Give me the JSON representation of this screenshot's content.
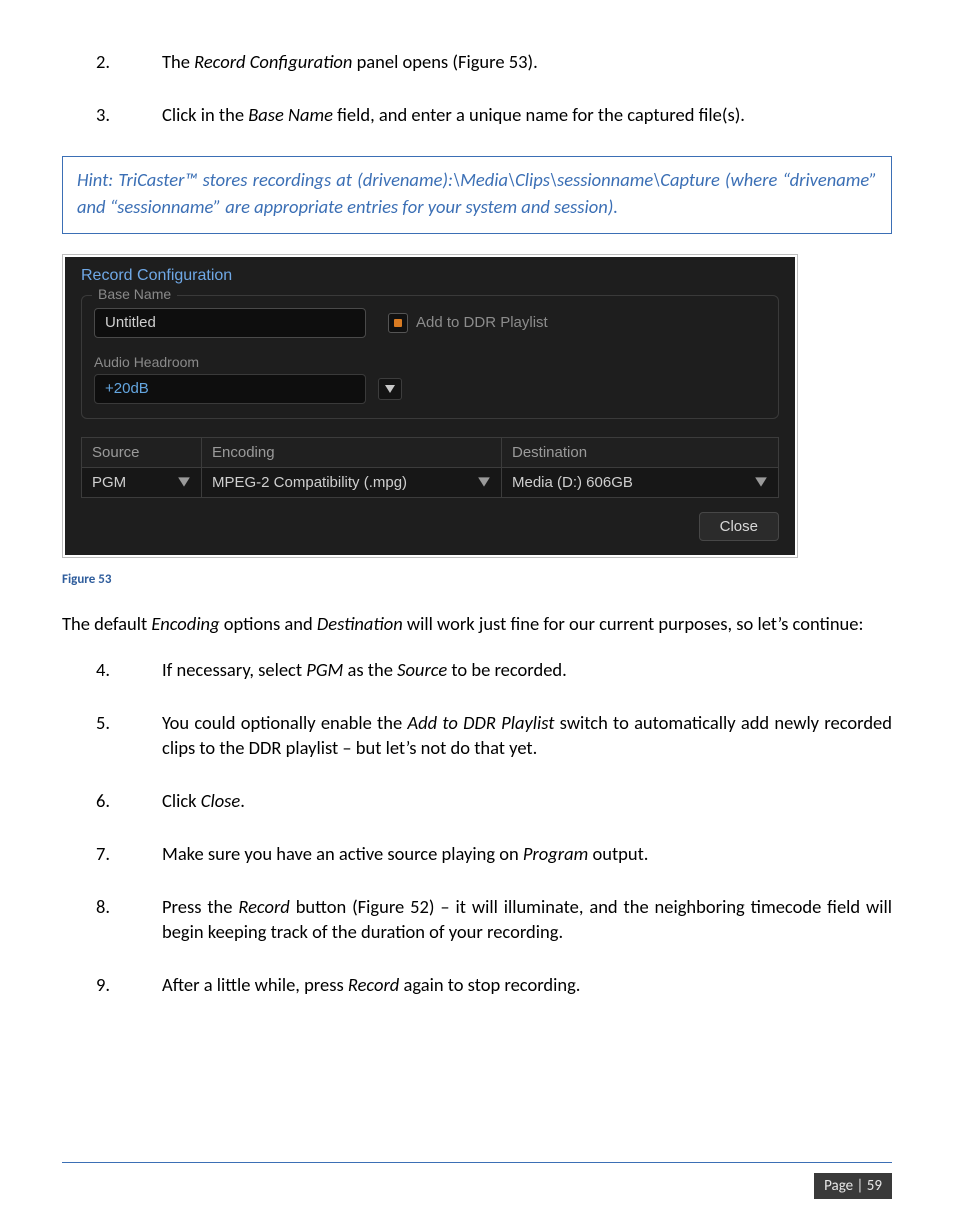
{
  "list_top": [
    {
      "num": "2.",
      "html": "The <i>Record Configuration</i> panel opens (Figure 53)."
    },
    {
      "num": "3.",
      "html": "Click in the <i>Base Name</i> field, and enter a unique name for the captured file(s)."
    }
  ],
  "hint": "Hint: TriCaster™ stores recordings at (drivename):\\Media\\Clips\\sessionname\\Capture (where “drivename” and “sessionname” are appropriate entries for your system and session).",
  "panel": {
    "title": "Record Configuration",
    "group_label": "Base Name",
    "basename_value": "Untitled",
    "ddr_checkbox_label": "Add to DDR Playlist",
    "ddr_checked": false,
    "headroom_label": "Audio Headroom",
    "headroom_value": "+20dB",
    "columns": {
      "source": "Source",
      "encoding": "Encoding",
      "destination": "Destination"
    },
    "row": {
      "source": "PGM",
      "encoding": "MPEG-2 Compatibility (.mpg)",
      "destination": "Media (D:) 606GB"
    },
    "close_label": "Close"
  },
  "figure_caption": "Figure 53",
  "para_after": "The default <i>Encoding</i> options and <i>Destination</i> will work just fine for our current purposes, so let’s continue:",
  "list_bottom": [
    {
      "num": "4.",
      "html": "If necessary, select <i>PGM</i> as the <i>Source</i> to be recorded."
    },
    {
      "num": "5.",
      "html": "You could optionally enable the <i>Add to DDR Playlist</i> switch to automatically add newly recorded clips to the DDR playlist – but let’s not do that yet."
    },
    {
      "num": "6.",
      "html": "Click <i>Close</i>."
    },
    {
      "num": "7.",
      "html": "Make sure you have an active source playing on <i>Program</i> output."
    },
    {
      "num": "8.",
      "html": "Press the <i>Record</i> button (Figure 52) – it will illuminate, and the neighboring timecode field will begin keeping track of the duration of your recording."
    },
    {
      "num": "9.",
      "html": "After a little while, press <i>Record</i> again to stop recording."
    }
  ],
  "page_number": "Page | 59"
}
